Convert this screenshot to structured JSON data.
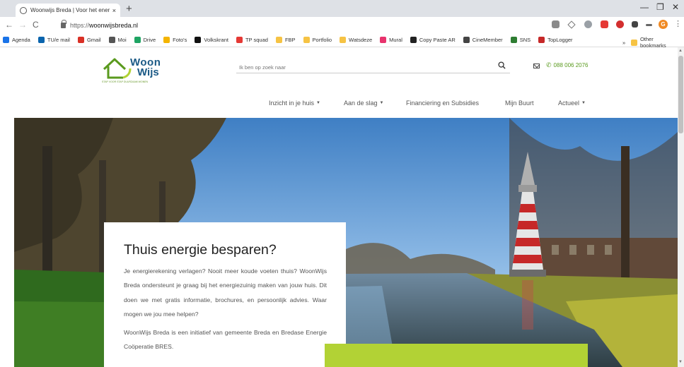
{
  "browser": {
    "tab_title": "Woonwijs Breda | Voor het ener",
    "tab_close": "×",
    "new_tab": "+",
    "url_protocol": "https://",
    "url_host": "woonwijsbreda.nl",
    "window_controls": [
      "—",
      "❐",
      "✕"
    ],
    "profile_initial": "G",
    "bookmarks": [
      {
        "label": "Agenda",
        "color": "#1a73e8"
      },
      {
        "label": "TU/e mail",
        "color": "#0a64ad"
      },
      {
        "label": "Gmail",
        "color": "#d93025"
      },
      {
        "label": "Moi",
        "color": "#555555"
      },
      {
        "label": "Drive",
        "color": "#1fa463"
      },
      {
        "label": "Foto's",
        "color": "#f4b400"
      },
      {
        "label": "Volkskrant",
        "color": "#111111"
      },
      {
        "label": "TP squad",
        "color": "#e53935"
      },
      {
        "label": "FBP",
        "color": "#f6c344"
      },
      {
        "label": "Portfolio",
        "color": "#f6c344"
      },
      {
        "label": "Watsdeze",
        "color": "#f6c344"
      },
      {
        "label": "Mural",
        "color": "#e8336d"
      },
      {
        "label": "Copy Paste AR",
        "color": "#222222"
      },
      {
        "label": "CineMember",
        "color": "#444444"
      },
      {
        "label": "SNS",
        "color": "#2e7d32"
      },
      {
        "label": "TopLogger",
        "color": "#c62828"
      }
    ],
    "bookmarks_more": "»",
    "other_bookmarks": "Other bookmarks"
  },
  "site": {
    "logo_word1": "Woon",
    "logo_word2": "Wijs",
    "logo_tagline": "STAP VOOR STAP DUURZAAM WONEN",
    "search_placeholder": "Ik ben op zoek naar",
    "phone": "088 006 2076",
    "nav": [
      {
        "label": "Inzicht in je huis",
        "dropdown": true
      },
      {
        "label": "Aan de slag",
        "dropdown": true
      },
      {
        "label": "Financiering en Subsidies",
        "dropdown": false
      },
      {
        "label": "Mijn Buurt",
        "dropdown": false
      },
      {
        "label": "Actueel",
        "dropdown": true
      }
    ],
    "caret": "▼",
    "brand_green": "#b2d235",
    "brand_blue": "#1b5a86"
  },
  "hero": {
    "heading": "Thuis energie besparen?",
    "paragraph1": "Je energierekening verlagen? Nooit meer koude voeten thuis? WoonWijs Breda ondersteunt je graag bij het energiezuinig maken van jouw huis. Dit doen we met gratis informatie, brochures, en persoonlijk advies. Waar mogen we jou mee helpen?",
    "paragraph2": "WoonWijs Breda is een initiatief van gemeente Breda en Bredase Energie Coöperatie BRES."
  }
}
